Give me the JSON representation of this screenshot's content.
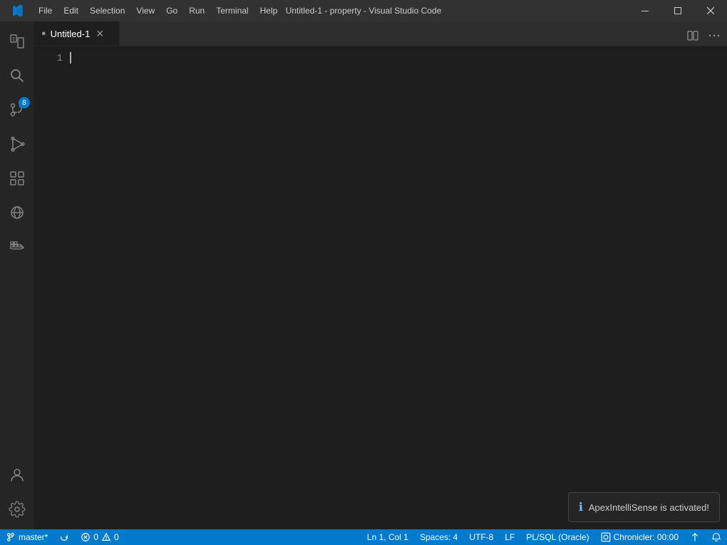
{
  "titlebar": {
    "title": "Untitled-1 - property - Visual Studio Code",
    "menu": [
      "File",
      "Edit",
      "Selection",
      "View",
      "Go",
      "Run",
      "Terminal",
      "Help"
    ],
    "window_buttons": [
      "minimize",
      "maximize",
      "close"
    ]
  },
  "tabs": {
    "active_tab": {
      "label": "Untitled-1",
      "dirty": false
    },
    "actions": [
      "split-editor",
      "more-actions"
    ]
  },
  "editor": {
    "line_number": "1",
    "cursor_visible": true
  },
  "notification": {
    "icon": "ℹ",
    "message": "ApexIntelliSense is activated!"
  },
  "statusbar": {
    "branch": "master*",
    "sync_icon": "⟳",
    "errors": "0",
    "warnings": "0",
    "position": "Ln 1, Col 1",
    "spaces": "Spaces: 4",
    "encoding": "UTF-8",
    "line_ending": "LF",
    "language": "PL/SQL (Oracle)",
    "chronicler": "Chronicler: 00:00",
    "live_share_icon": "↕",
    "remote_icon": "⊞"
  },
  "activity_bar": {
    "items": [
      {
        "name": "explorer",
        "label": "Explorer"
      },
      {
        "name": "search",
        "label": "Search"
      },
      {
        "name": "source-control",
        "label": "Source Control",
        "badge": "8"
      },
      {
        "name": "run-debug",
        "label": "Run and Debug"
      },
      {
        "name": "extensions",
        "label": "Extensions"
      },
      {
        "name": "remote-explorer",
        "label": "Remote Explorer"
      },
      {
        "name": "docker",
        "label": "Docker"
      }
    ],
    "bottom_items": [
      {
        "name": "accounts",
        "label": "Accounts"
      },
      {
        "name": "settings",
        "label": "Settings"
      }
    ]
  }
}
